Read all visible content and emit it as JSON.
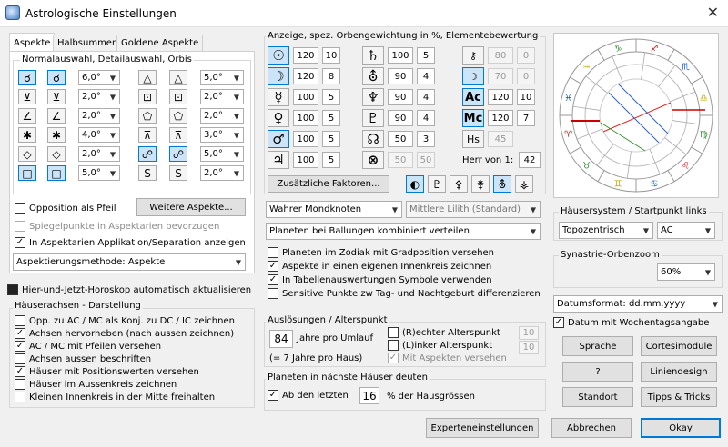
{
  "window": {
    "title": "Astrologische Einstellungen",
    "close": "✕"
  },
  "tabs": [
    "Aspekte",
    "Halbsummen",
    "Goldene Aspekte"
  ],
  "aspects": {
    "group_label": "Normalauswahl, Detailauswahl, Orbis",
    "rows_left": [
      {
        "sym": "☌",
        "orb": "6,0°"
      },
      {
        "sym": "⊻",
        "orb": "2,0°"
      },
      {
        "sym": "∠",
        "orb": "2,0°"
      },
      {
        "sym": "✱",
        "orb": "4,0°"
      },
      {
        "sym": "◇",
        "orb": "2,0°"
      },
      {
        "sym": "□",
        "orb": "5,0°"
      }
    ],
    "rows_right": [
      {
        "sym": "△",
        "orb": "5,0°"
      },
      {
        "sym": "⊡",
        "orb": "2,0°"
      },
      {
        "sym": "⬠",
        "orb": "2,0°"
      },
      {
        "sym": "⊼",
        "orb": "3,0°"
      },
      {
        "sym": "☍",
        "orb": "5,0°"
      },
      {
        "sym": "S",
        "orb": "2,0°"
      }
    ],
    "opposition_arrow": "Opposition als Pfeil",
    "more_button": "Weitere Aspekte...",
    "mirror_points": "Spiegelpunkte in Aspektarien bevorzugen",
    "app_sep": "In Aspektarien Applikation/Separation anzeigen",
    "method": "Aspektierungsmethode: Aspekte"
  },
  "auto_update": "Hier-und-Jetzt-Horoskop automatisch aktualisieren",
  "house_axes": {
    "label": "Häuserachsen - Darstellung",
    "options": [
      {
        "text": "Opp. zu  AC / MC als Konj. zu DC / IC zeichnen",
        "checked": false
      },
      {
        "text": "Achsen hervorheben (nach aussen zeichnen)",
        "checked": true
      },
      {
        "text": "AC / MC mit Pfeilen versehen",
        "checked": true
      },
      {
        "text": "Achsen aussen beschriften",
        "checked": false
      },
      {
        "text": "Häuser mit Positionswerten versehen",
        "checked": true
      },
      {
        "text": "Häuser im Aussenkreis zeichnen",
        "checked": false
      },
      {
        "text": "Kleinen Innenkreis in der Mitte freihalten",
        "checked": false
      }
    ]
  },
  "weights": {
    "label": "Anzeige, spez. Orbengewichtung in %, Elementebewertung",
    "col1": [
      {
        "sym": "☉",
        "pct": "120",
        "el": "10"
      },
      {
        "sym": "☽",
        "pct": "120",
        "el": "8"
      },
      {
        "sym": "☿",
        "pct": "100",
        "el": "5"
      },
      {
        "sym": "♀",
        "pct": "100",
        "el": "5"
      },
      {
        "sym": "♂",
        "pct": "100",
        "el": "5"
      },
      {
        "sym": "♃",
        "pct": "100",
        "el": "5"
      }
    ],
    "col2": [
      {
        "sym": "♄",
        "pct": "100",
        "el": "5"
      },
      {
        "sym": "⛢",
        "pct": "90",
        "el": "4"
      },
      {
        "sym": "♆",
        "pct": "90",
        "el": "4"
      },
      {
        "sym": "♇",
        "pct": "90",
        "el": "4"
      },
      {
        "sym": "☊",
        "pct": "50",
        "el": "3"
      },
      {
        "sym": "⊗",
        "pct": "50",
        "el": "50"
      }
    ],
    "col3": [
      {
        "sym": "⚷",
        "pct": "80",
        "el": "0"
      },
      {
        "sym": "☽",
        "pct": "70",
        "el": "0"
      },
      {
        "sym": "Ac",
        "pct": "120",
        "el": "10"
      },
      {
        "sym": "Mc",
        "pct": "120",
        "el": "7"
      },
      {
        "sym": "Hs",
        "pct": "45",
        "el": ""
      }
    ],
    "herr_label": "Herr von 1:",
    "herr_value": "42",
    "extra_button": "Zusätzliche Faktoren...",
    "extra_icons": [
      "◐",
      "♇",
      "⚴",
      "⚵",
      "⛢",
      "⚶"
    ]
  },
  "moon_node": "Wahrer Mondknoten",
  "lilith": "Mittlere Lilith (Standard)",
  "planet_cluster": "Planeten bei Ballungen kombiniert verteilen",
  "display_options": [
    {
      "text": "Planeten im Zodiak mit Gradposition versehen",
      "checked": false
    },
    {
      "text": "Aspekte in einen eigenen Innenkreis zeichnen",
      "checked": true
    },
    {
      "text": "In Tabellenauswertungen Symbole verwenden",
      "checked": true
    },
    {
      "text": "Sensitive Punkte zw Tag- und Nachtgeburt differenzieren",
      "checked": false
    }
  ],
  "triggers": {
    "label": "Auslösungen / Alterspunkt",
    "years": "84",
    "years_label": "Jahre pro Umlauf",
    "years_note": "(= 7 Jahre pro Haus)",
    "right_point": "(R)echter Alterspunkt",
    "left_point": "(L)inker Alterspunkt",
    "with_aspects": "Mit Aspekten versehen",
    "right_val": "10",
    "left_val": "10"
  },
  "next_house": {
    "label": "Planeten in nächste Häuser deuten",
    "from": "Ab den letzten",
    "value": "16",
    "suffix": "% der Hausgrössen"
  },
  "house_system": {
    "label": "Häusersystem / Startpunkt links",
    "system": "Topozentrisch",
    "start": "AC"
  },
  "synastry": {
    "label": "Synastrie-Orbenzoom",
    "value": "60%"
  },
  "date_format": "Datumsformat: dd.mm.yyyy",
  "weekday": "Datum mit Wochentagsangabe",
  "side_buttons": [
    "Sprache",
    "Cortesimodule",
    "?",
    "Liniendesign",
    "Standort",
    "Tipps & Tricks"
  ],
  "footer": {
    "expert": "Experteneinstellungen",
    "cancel": "Abbrechen",
    "ok": "Okay"
  },
  "zodiac_glyphs": [
    "♈",
    "♉",
    "♊",
    "♋",
    "♌",
    "♍",
    "♎",
    "♏",
    "♐",
    "♑",
    "♒",
    "♓"
  ],
  "colors": {
    "accent": "#0078d7",
    "selected": "#cce4f7",
    "fire": "#d11",
    "earth": "#2a8a2a",
    "air": "#c8a600",
    "water": "#1a5fd1"
  }
}
